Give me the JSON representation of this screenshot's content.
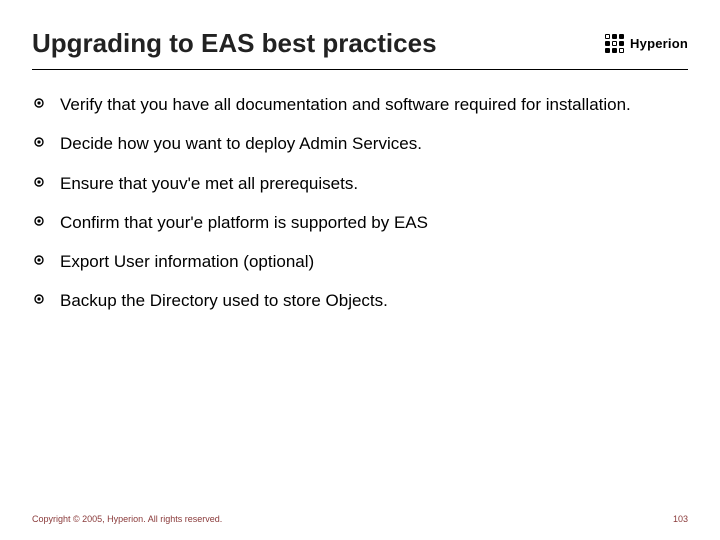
{
  "header": {
    "title": "Upgrading to EAS best practices",
    "brand": "Hyperion"
  },
  "bullets": [
    "Verify that you have all documentation and software required for installation.",
    "Decide how you want to deploy Admin Services.",
    "Ensure that youv'e met all prerequisets.",
    "Confirm that your'e platform is supported by EAS",
    "Export User information (optional)",
    "Backup the Directory used to store Objects."
  ],
  "footer": {
    "copyright": "Copyright © 2005, Hyperion. All rights reserved.",
    "page": "103"
  }
}
